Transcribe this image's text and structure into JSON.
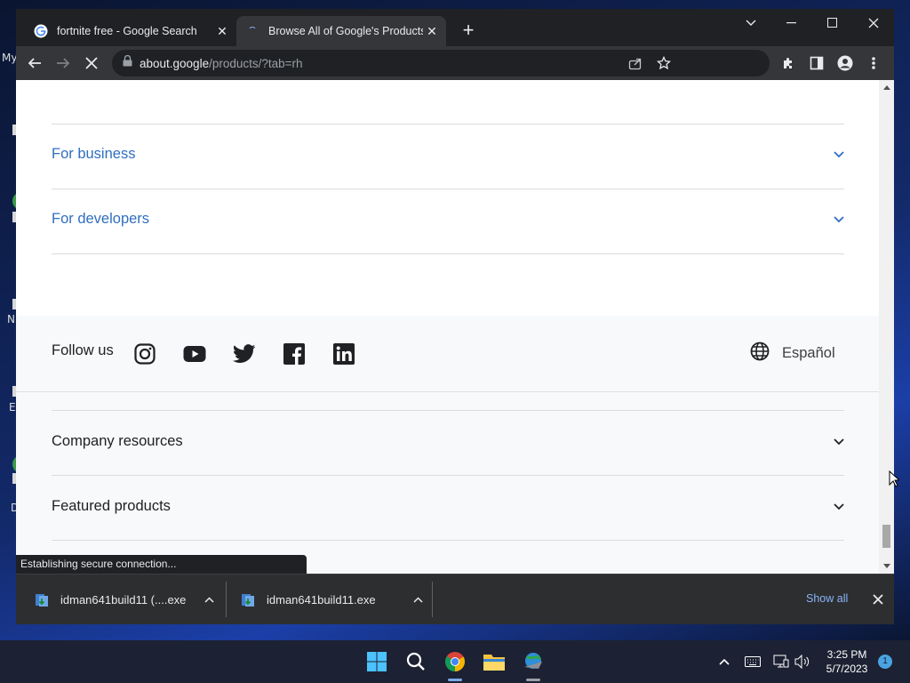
{
  "desktop": {
    "fragments": [
      "My",
      "N",
      "E",
      "D"
    ]
  },
  "browser": {
    "tabs": [
      {
        "title": "fortnite free - Google Search",
        "favicon": "google-g-icon",
        "active": false
      },
      {
        "title": "Browse All of Google's Products",
        "favicon": "loading-spinner-icon",
        "active": true
      }
    ],
    "url_host": "about.google",
    "url_path": "/products/?tab=rh"
  },
  "page": {
    "accordion_top": [
      {
        "label": "For business"
      },
      {
        "label": "For developers"
      }
    ],
    "follow_us": "Follow us",
    "social": [
      "instagram-icon",
      "youtube-icon",
      "twitter-icon",
      "facebook-icon",
      "linkedin-icon"
    ],
    "language": "Español",
    "accordion_bottom": [
      {
        "label": "Company resources"
      },
      {
        "label": "Featured products"
      }
    ]
  },
  "status_text": "Establishing secure connection...",
  "downloads": {
    "items": [
      {
        "name": "idman641build11 (....exe"
      },
      {
        "name": "idman641build11.exe"
      }
    ],
    "show_all": "Show all"
  },
  "taskbar": {
    "time": "3:25 PM",
    "date": "5/7/2023",
    "notification_count": "1"
  },
  "colors": {
    "link_blue": "#2f6fbf",
    "chrome_dark": "#202124",
    "toolbar": "#35363a"
  }
}
